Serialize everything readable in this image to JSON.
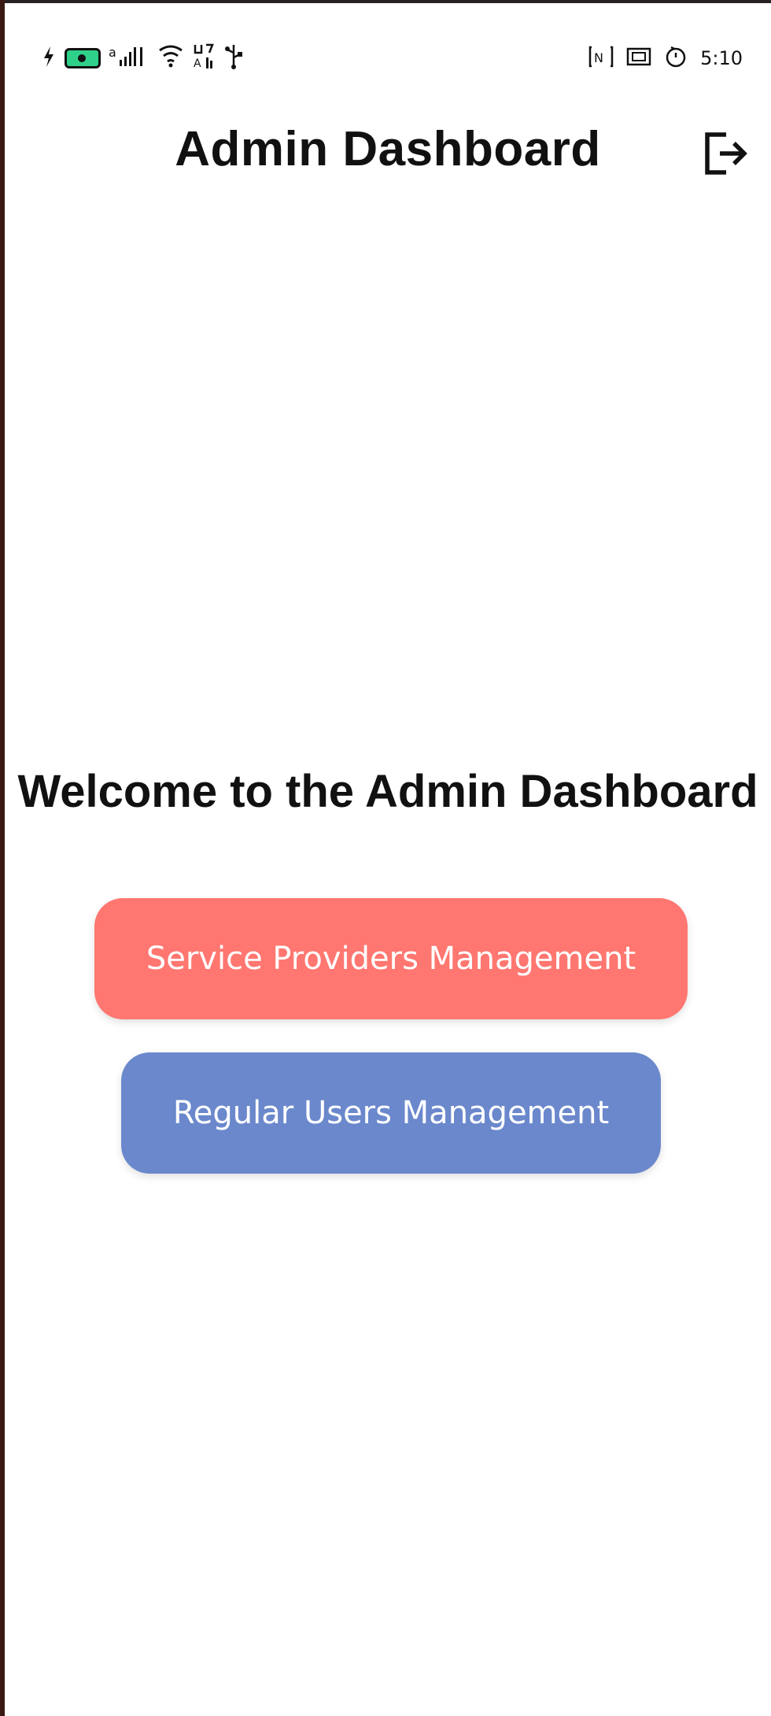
{
  "status_bar": {
    "left_icons": [
      "charging-icon",
      "battery-icon",
      "signal-icon",
      "wifi-icon",
      "data-icon",
      "usb-icon"
    ],
    "right_icons": [
      "nfc-icon",
      "vibrate-icon",
      "alarm-icon"
    ],
    "time": "5:10"
  },
  "app_bar": {
    "title": "Admin Dashboard",
    "logout_icon": "logout-icon"
  },
  "main": {
    "welcome_text": "Welcome to the Admin Dashboard",
    "buttons": [
      {
        "label": "Service Providers Management",
        "color": "#ff7770"
      },
      {
        "label": "Regular Users Management",
        "color": "#6b88cc"
      }
    ]
  },
  "colors": {
    "background": "#ffffff",
    "text": "#111111",
    "battery": "#2fd18a"
  }
}
